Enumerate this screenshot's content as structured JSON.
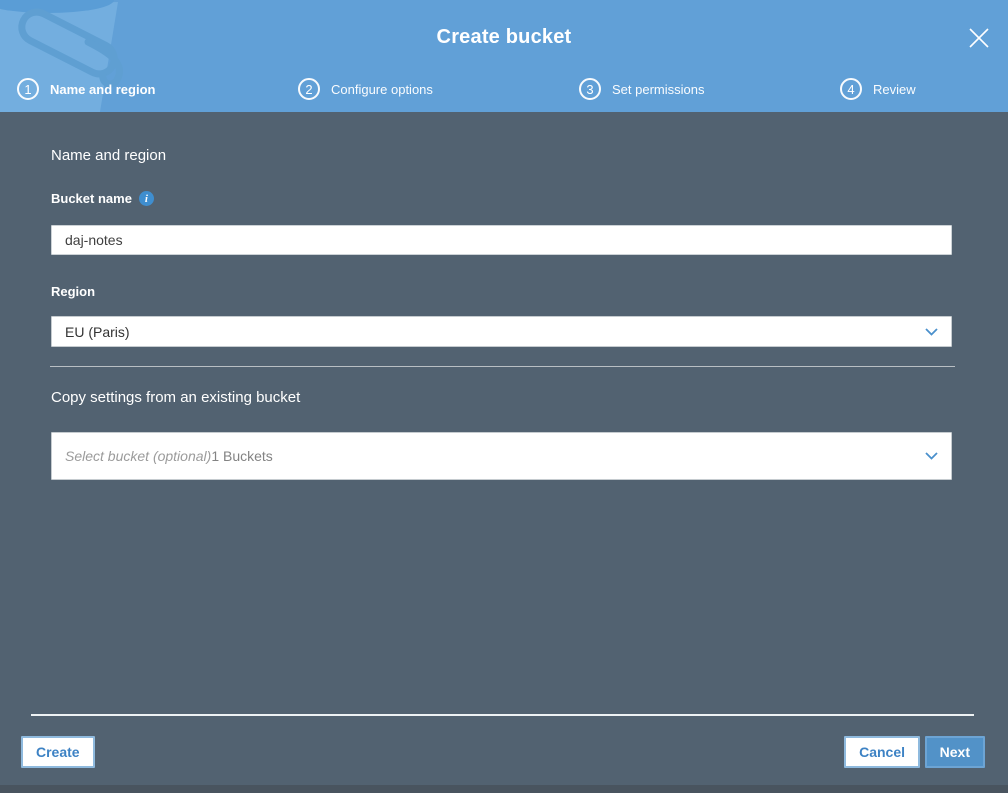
{
  "header": {
    "title": "Create bucket",
    "steps": [
      {
        "number": "1",
        "label": "Name and region"
      },
      {
        "number": "2",
        "label": "Configure options"
      },
      {
        "number": "3",
        "label": "Set permissions"
      },
      {
        "number": "4",
        "label": "Review"
      }
    ]
  },
  "form": {
    "section_title": "Name and region",
    "bucket_name_label": "Bucket name",
    "bucket_name_value": "daj-notes",
    "region_label": "Region",
    "region_value": "EU (Paris)",
    "copy_section_title": "Copy settings from an existing bucket",
    "copy_placeholder": "Select bucket (optional)",
    "copy_suffix": "1 Buckets"
  },
  "footer": {
    "create_label": "Create",
    "cancel_label": "Cancel",
    "next_label": "Next"
  },
  "icons": {
    "info": "i"
  },
  "colors": {
    "header_blue": "#61a0d7",
    "body_slate": "#526271",
    "accent_blue": "#4a90cc",
    "primary_button_blue": "#5292c8",
    "button_border_blue": "#8fbade"
  }
}
